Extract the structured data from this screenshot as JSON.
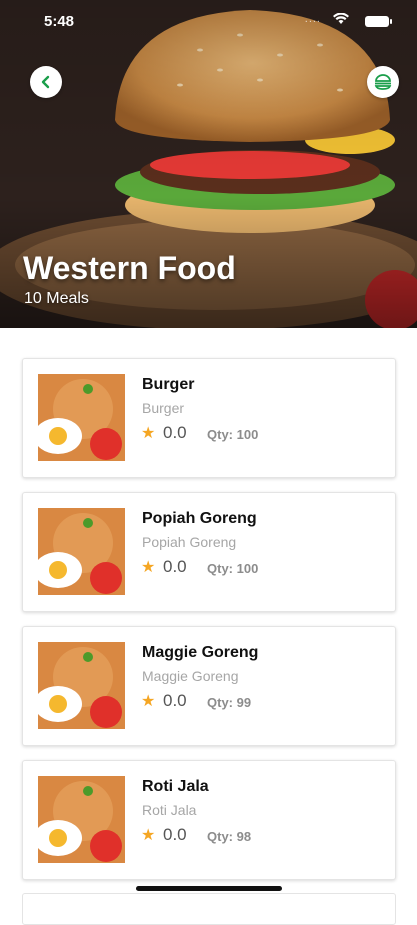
{
  "status_bar": {
    "time": "5:48",
    "signal": "....",
    "wifi_icon": "wifi-icon",
    "battery_icon": "battery-icon"
  },
  "header": {
    "title": "Western Food",
    "subtitle": "10 Meals",
    "back_icon": "chevron-left-icon",
    "menu_icon": "food-menu-icon"
  },
  "colors": {
    "accent": "#1a9e4a",
    "star": "#f5a623",
    "subtext": "#a6a6a6"
  },
  "meals": [
    {
      "name": "Burger",
      "subtitle": "Burger",
      "rating": "0.0",
      "qty": "Qty: 100"
    },
    {
      "name": "Popiah Goreng",
      "subtitle": "Popiah Goreng",
      "rating": "0.0",
      "qty": "Qty: 100"
    },
    {
      "name": "Maggie Goreng",
      "subtitle": "Maggie Goreng",
      "rating": "0.0",
      "qty": "Qty: 99"
    },
    {
      "name": "Roti Jala",
      "subtitle": "Roti Jala",
      "rating": "0.0",
      "qty": "Qty: 98"
    }
  ]
}
